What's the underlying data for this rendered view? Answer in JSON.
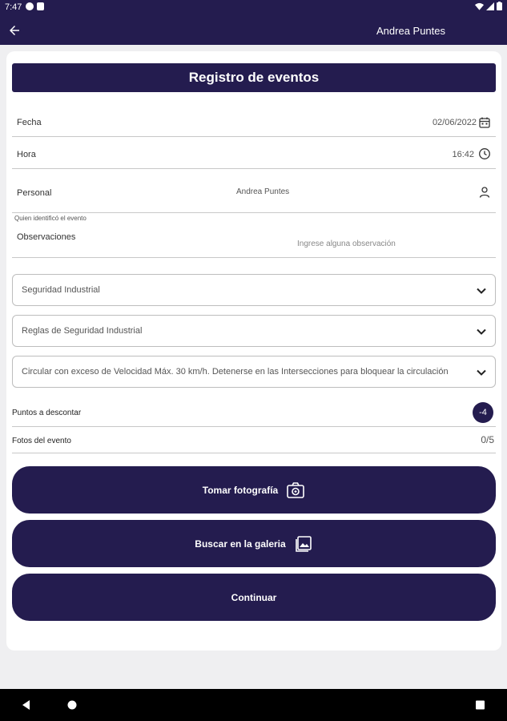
{
  "status_bar": {
    "time": "7:47"
  },
  "app_bar": {
    "user_name": "Andrea Puntes"
  },
  "form": {
    "title": "Registro de eventos",
    "fecha": {
      "label": "Fecha",
      "value": "02/06/2022"
    },
    "hora": {
      "label": "Hora",
      "value": "16:42"
    },
    "personal": {
      "label": "Personal",
      "value": "Andrea Puntes",
      "hint": "Quien identificó el evento"
    },
    "observaciones": {
      "label": "Observaciones",
      "placeholder": "Ingrese alguna observación"
    },
    "selects": [
      {
        "value": "Seguridad Industrial"
      },
      {
        "value": "Reglas de Seguridad Industrial"
      },
      {
        "value": "Circular con exceso de Velocidad Máx. 30 km/h. Detenerse en las Intersecciones para bloquear la circulación"
      }
    ],
    "puntos": {
      "label": "Puntos a descontar",
      "value": "-4"
    },
    "fotos": {
      "label": "Fotos del evento",
      "value": "0/5"
    }
  },
  "buttons": {
    "photo": "Tomar fotografía",
    "gallery": "Buscar en la galeria",
    "continue": "Continuar"
  },
  "colors": {
    "primary": "#241c4f",
    "background": "#efeff1"
  }
}
